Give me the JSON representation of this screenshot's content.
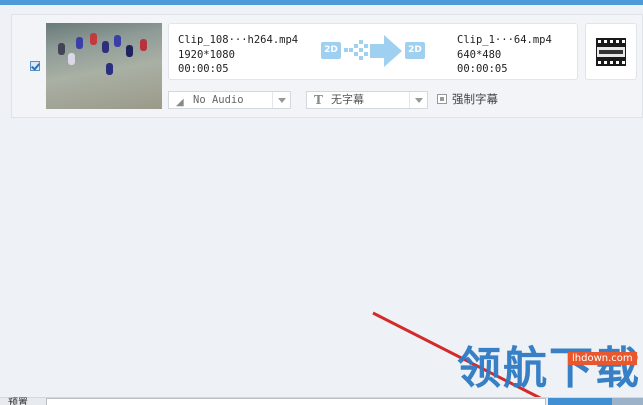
{
  "file_item": {
    "checked": true,
    "source": {
      "name": "Clip_108···h264.mp4",
      "resolution": "1920*1080",
      "duration": "00:00:05"
    },
    "mode_badge_in": "2D",
    "mode_badge_out": "2D",
    "output": {
      "name": "Clip_1···64.mp4",
      "resolution": "640*480",
      "duration": "00:00:05"
    },
    "codec_icon": "mpeg-film-icon",
    "audio_track": "No Audio",
    "subtitle": "无字幕",
    "force_subtitle_label": "强制字幕"
  },
  "bottom": {
    "profile_label": "预置"
  },
  "watermark": {
    "text": "领航下载",
    "url": "lhdown.com"
  },
  "colors": {
    "accent": "#4a9bd8",
    "arrow": "#d42a2a",
    "watermark": "#2e7bc4"
  }
}
